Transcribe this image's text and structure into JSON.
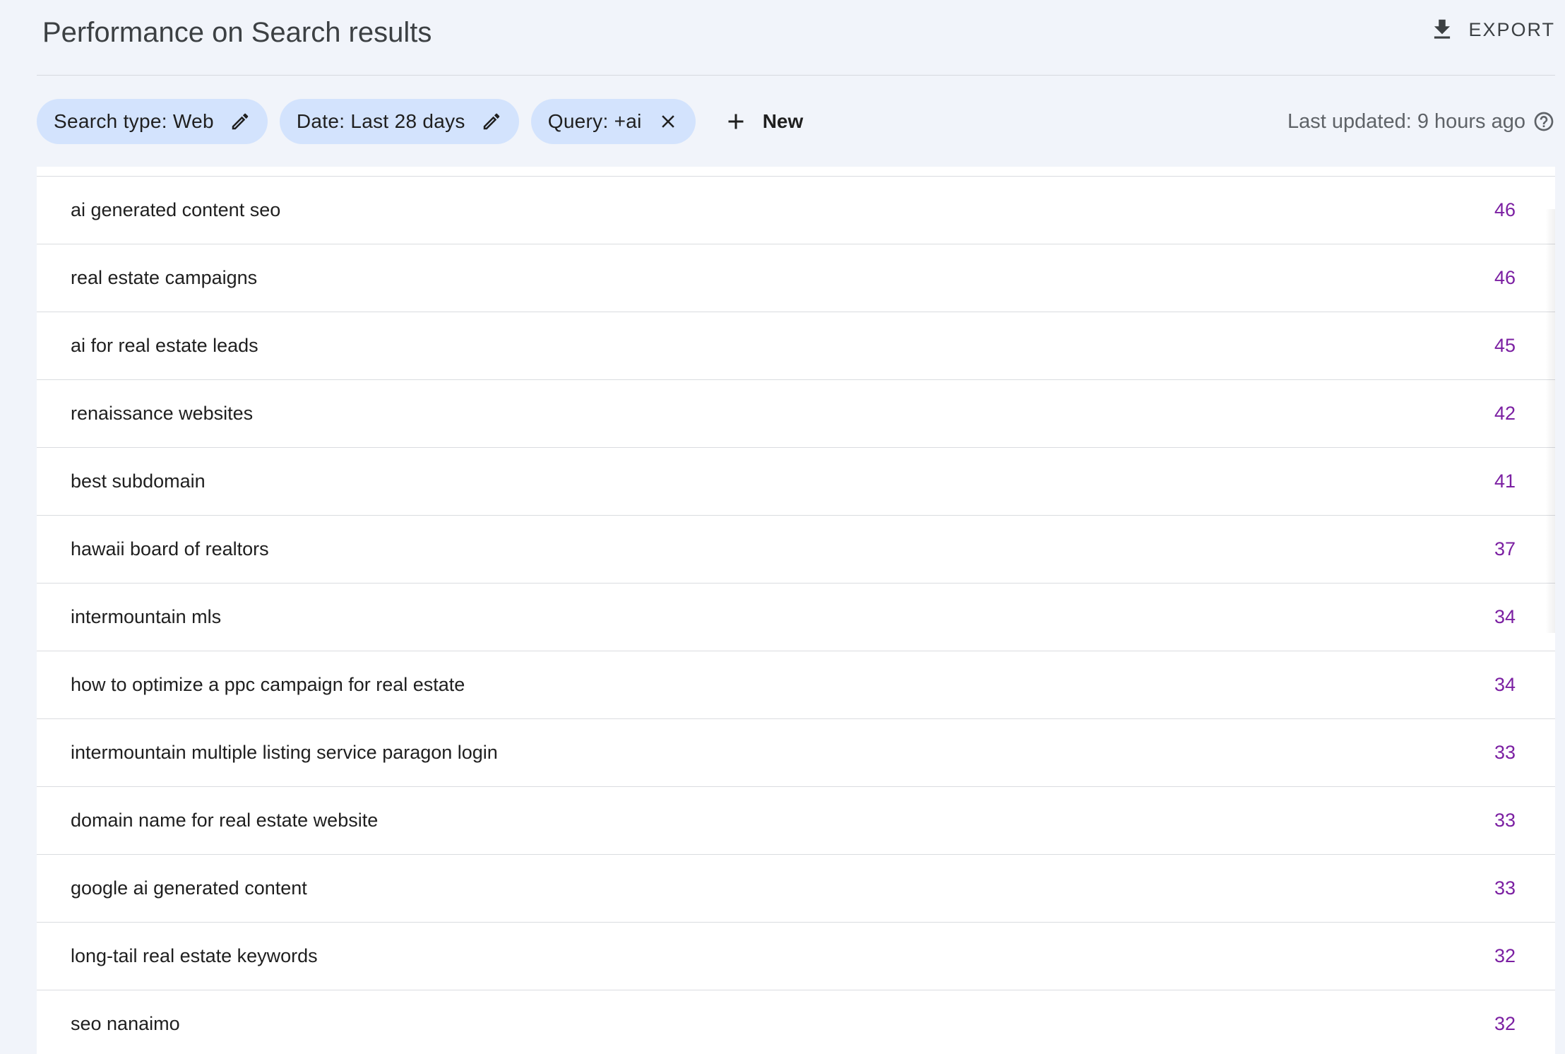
{
  "header": {
    "title": "Performance on Search results",
    "export_label": "EXPORT"
  },
  "filters": {
    "chips": [
      {
        "label": "Search type: Web",
        "icon": "pencil-icon"
      },
      {
        "label": "Date: Last 28 days",
        "icon": "pencil-icon"
      },
      {
        "label": "Query: +ai",
        "icon": "close-icon"
      }
    ],
    "new_label": "New",
    "last_updated": "Last updated: 9 hours ago"
  },
  "colors": {
    "chip_bg": "#d3e3fd",
    "value_text": "#7b1fa2",
    "page_bg": "#f1f4fa"
  },
  "table": {
    "rows": [
      {
        "query": "ai generated content seo",
        "value": "46"
      },
      {
        "query": "real estate campaigns",
        "value": "46"
      },
      {
        "query": "ai for real estate leads",
        "value": "45"
      },
      {
        "query": "renaissance websites",
        "value": "42"
      },
      {
        "query": "best subdomain",
        "value": "41"
      },
      {
        "query": "hawaii board of realtors",
        "value": "37"
      },
      {
        "query": "intermountain mls",
        "value": "34"
      },
      {
        "query": "how to optimize a ppc campaign for real estate",
        "value": "34"
      },
      {
        "query": "intermountain multiple listing service paragon login",
        "value": "33"
      },
      {
        "query": "domain name for real estate website",
        "value": "33"
      },
      {
        "query": "google ai generated content",
        "value": "33"
      },
      {
        "query": "long-tail real estate keywords",
        "value": "32"
      },
      {
        "query": "seo nanaimo",
        "value": "32"
      }
    ]
  }
}
